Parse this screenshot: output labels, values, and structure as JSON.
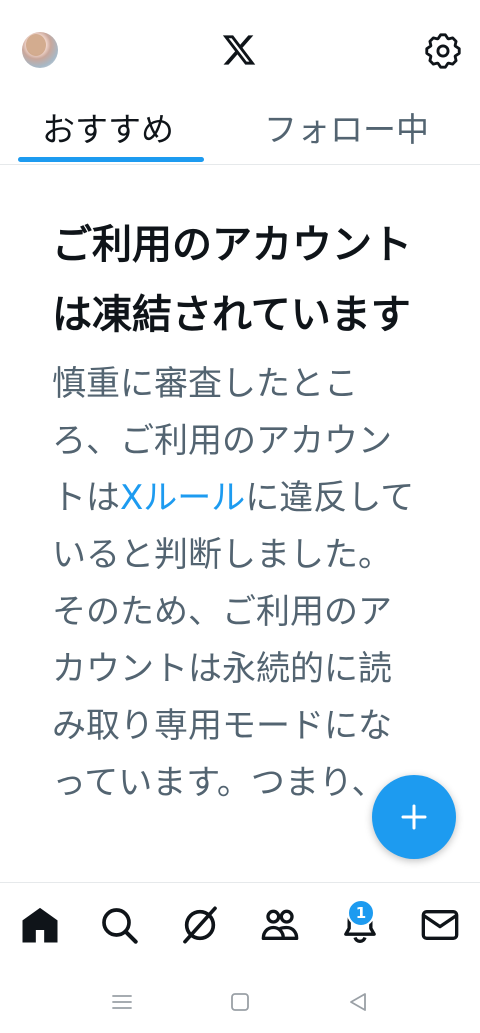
{
  "header": {
    "logo": "X",
    "avatar": "user-avatar",
    "settings_icon": "gear-icon"
  },
  "tabs": [
    {
      "label": "おすすめ",
      "active": true
    },
    {
      "label": "フォロー中",
      "active": false
    }
  ],
  "content": {
    "title": "ご利用のアカウントは凍結されています",
    "body_before": "慎重に審査したところ、ご利用のアカウントは",
    "body_link": "Xルール",
    "body_after": "に違反していると判断しました。そのため、ご利用のアカウントは永続的に読み取り専用モードになっています。つまり、"
  },
  "fab": {
    "icon": "plus-icon"
  },
  "bottom_nav": {
    "items": [
      "home-icon",
      "search-icon",
      "grok-icon",
      "communities-icon",
      "notifications-icon",
      "messages-icon"
    ],
    "notification_count": "1"
  },
  "system_nav": [
    "recent-apps-icon",
    "home-button-icon",
    "back-icon"
  ],
  "colors": {
    "accent": "#1d9bf0",
    "text": "#0f1419",
    "secondary": "#536471"
  }
}
